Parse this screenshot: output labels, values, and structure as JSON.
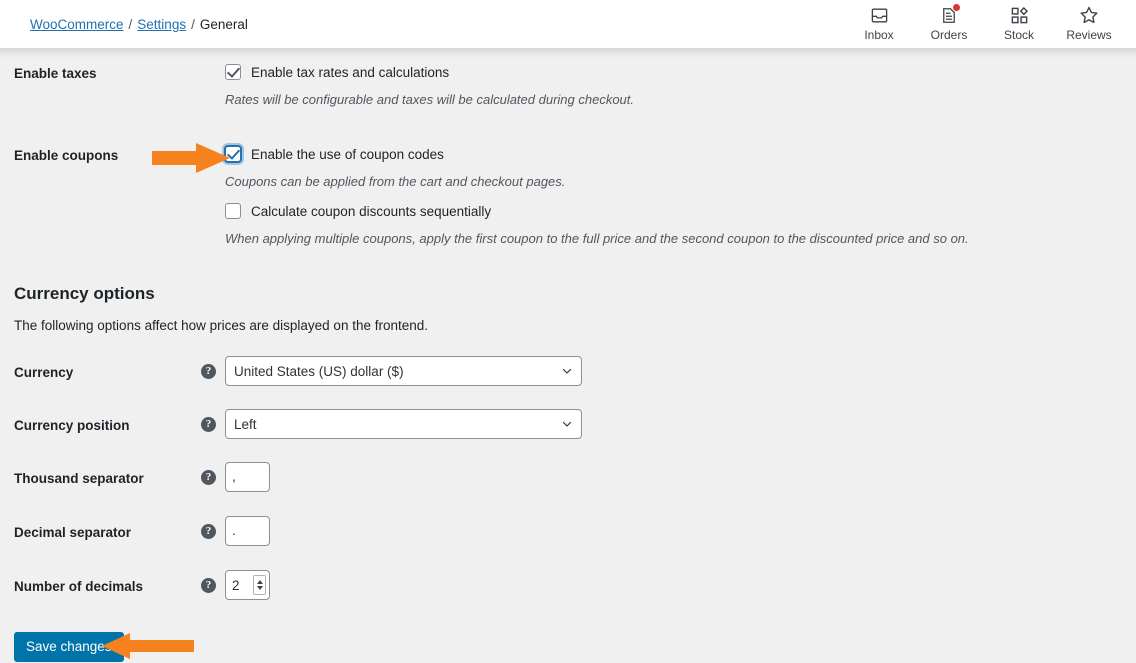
{
  "header": {
    "breadcrumb": {
      "items": [
        {
          "label": "WooCommerce",
          "link": true
        },
        {
          "label": "Settings",
          "link": true
        },
        {
          "label": "General",
          "link": false
        }
      ],
      "separator": "/"
    },
    "actions": [
      {
        "label": "Inbox",
        "icon": "inbox-icon",
        "badge": false
      },
      {
        "label": "Orders",
        "icon": "orders-icon",
        "badge": true
      },
      {
        "label": "Stock",
        "icon": "stock-icon",
        "badge": false
      },
      {
        "label": "Reviews",
        "icon": "star-icon",
        "badge": false
      }
    ]
  },
  "settings": {
    "enable_taxes": {
      "label": "Enable taxes",
      "checkbox_label": "Enable tax rates and calculations",
      "checked": true,
      "description": "Rates will be configurable and taxes will be calculated during checkout."
    },
    "enable_coupons": {
      "label": "Enable coupons",
      "checkbox_label": "Enable the use of coupon codes",
      "checked": true,
      "focused": true,
      "description": "Coupons can be applied from the cart and checkout pages.",
      "sequential": {
        "checkbox_label": "Calculate coupon discounts sequentially",
        "checked": false,
        "description": "When applying multiple coupons, apply the first coupon to the full price and the second coupon to the discounted price and so on."
      }
    }
  },
  "currency_options": {
    "title": "Currency options",
    "subtitle": "The following options affect how prices are displayed on the frontend.",
    "help_glyph": "?",
    "fields": [
      {
        "label": "Currency",
        "type": "select",
        "value": "United States (US) dollar ($)"
      },
      {
        "label": "Currency position",
        "type": "select",
        "value": "Left"
      },
      {
        "label": "Thousand separator",
        "type": "text",
        "value": ","
      },
      {
        "label": "Decimal separator",
        "type": "text",
        "value": "."
      },
      {
        "label": "Number of decimals",
        "type": "number",
        "value": "2"
      }
    ]
  },
  "footer": {
    "save_label": "Save changes"
  },
  "colors": {
    "accent_blue": "#0073aa",
    "annotation_orange": "#F5821F",
    "badge_red": "#d63638",
    "page_bg": "#f0f0f1"
  }
}
